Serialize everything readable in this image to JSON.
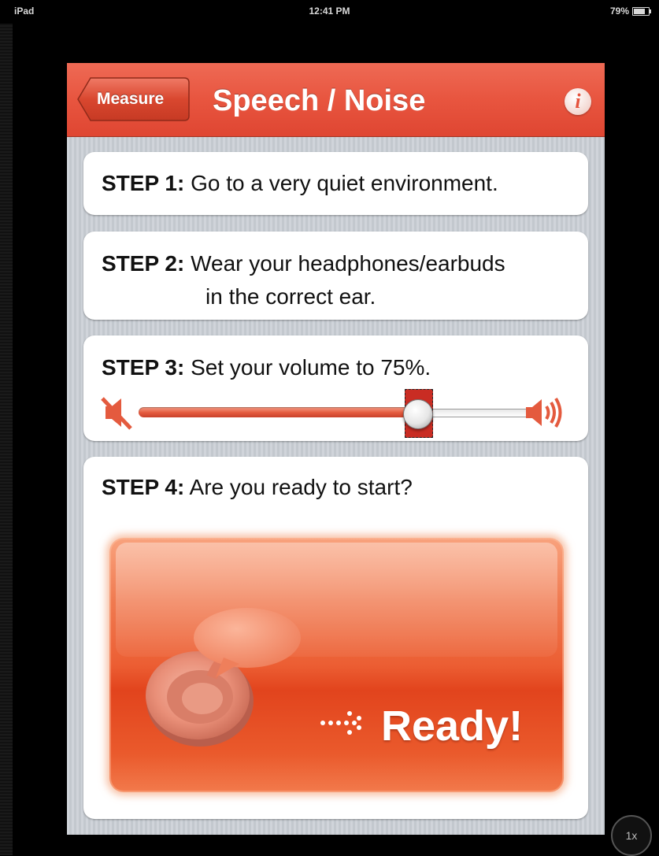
{
  "status_bar": {
    "device": "iPad",
    "time": "12:41 PM",
    "battery": "79%",
    "battery_level": 0.79
  },
  "navbar": {
    "back_label": "Measure",
    "title": "Speech / Noise",
    "info_icon": "info-icon"
  },
  "steps": [
    {
      "label": "STEP 1:",
      "text": "Go to a very quiet environment."
    },
    {
      "label": "STEP 2:",
      "text_line1": "Wear your headphones/earbuds",
      "text_line2": "in the correct ear."
    },
    {
      "label": "STEP 3:",
      "text": "Set your volume to 75%.",
      "volume_level": 0.75,
      "min_icon": "speaker-muted-icon",
      "max_icon": "speaker-loud-icon"
    },
    {
      "label": "STEP 4:",
      "text": "Are you ready to start?",
      "button_label": "Ready!"
    }
  ],
  "zoom": {
    "label": "1x"
  },
  "colors": {
    "accent": "#e8553f",
    "button": "#ec5e33",
    "background": "#c9ced5"
  }
}
